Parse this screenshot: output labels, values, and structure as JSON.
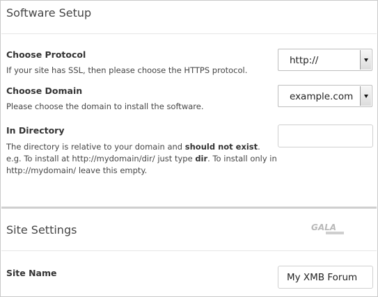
{
  "software_setup": {
    "title": "Software Setup",
    "protocol": {
      "label": "Choose Protocol",
      "description": "If your site has SSL, then please choose the HTTPS protocol.",
      "selected": "http://"
    },
    "domain": {
      "label": "Choose Domain",
      "description": "Please choose the domain to install the software.",
      "selected": "example.com"
    },
    "directory": {
      "label": "In Directory",
      "desc_part1": "The directory is relative to your domain and ",
      "desc_bold1": "should not exist",
      "desc_part2": ". e.g. To install at http://mydomain/dir/ just type ",
      "desc_bold2": "dir",
      "desc_part3": ". To install only in http://mydomain/ leave this empty.",
      "value": ""
    }
  },
  "site_settings": {
    "title": "Site Settings",
    "logo_text": "GALA",
    "site_name": {
      "label": "Site Name",
      "value": "My XMB Forum"
    }
  },
  "colors": {
    "border": "#c9c9c9",
    "divider": "#cfcfcf",
    "text": "#333333"
  }
}
